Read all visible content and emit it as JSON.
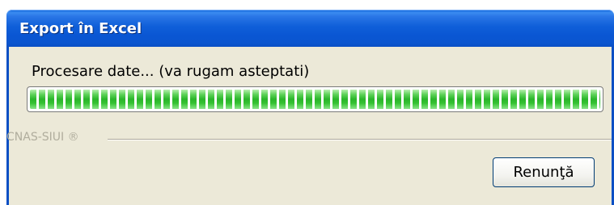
{
  "window": {
    "title": "Export în Excel"
  },
  "dialog": {
    "message": "Procesare date... (va rugam asteptati)",
    "progress": {
      "fraction": 1.0
    },
    "brand": "CNAS-SIUI ®",
    "cancel_label": "Renunţă"
  },
  "colors": {
    "titlebar": "#0a56d3",
    "client_background": "#ece9d8",
    "progress_green": "#2ab52a",
    "brand_text": "#b0ad9d"
  }
}
